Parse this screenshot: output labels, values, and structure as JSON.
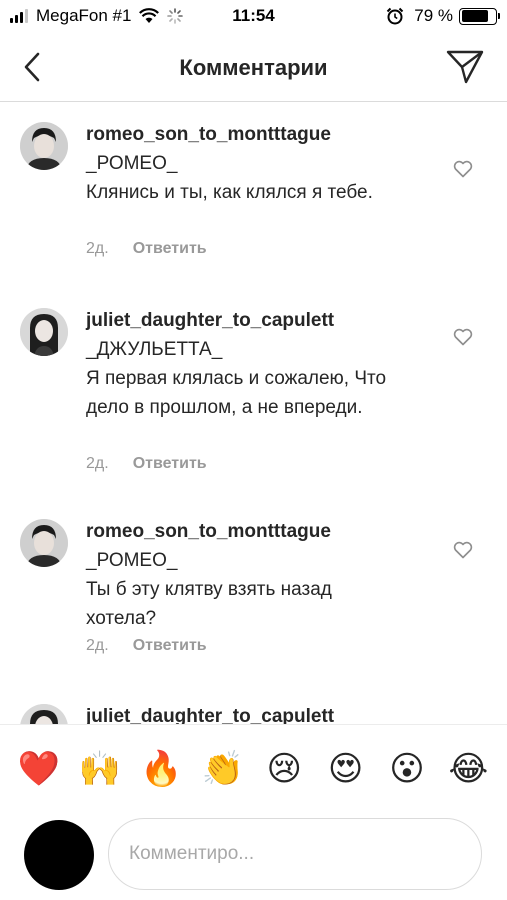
{
  "status_bar": {
    "carrier": "MegaFon #1",
    "time": "11:54",
    "battery": "79 %",
    "battery_level": 0.79
  },
  "nav": {
    "title": "Комментарии"
  },
  "comments": [
    {
      "username": "romeo_son_to_montttague",
      "text_line1": "_РОМЕО_",
      "text_line2": "Клянись и ты, как клялся я тебе.",
      "time": "2д.",
      "reply_label": "Ответить"
    },
    {
      "username": "juliet_daughter_to_capulett",
      "text_line1": "_ДЖУЛЬЕТТА_",
      "text_line2": "Я первая клялась и сожалею, Что дело в прошлом, а не впереди.",
      "time": "2д.",
      "reply_label": "Ответить"
    },
    {
      "username": "romeo_son_to_montttague",
      "text_line1": "_РОМЕО_",
      "text_line2": "Ты б эту клятву взять назад хотела?",
      "time": "2д.",
      "reply_label": "Ответить"
    },
    {
      "username": "juliet_daughter_to_capulett"
    }
  ],
  "emoji_bar": [
    "❤️",
    "🙌",
    "🔥",
    "👏",
    "😢",
    "😍",
    "😮",
    "😂"
  ],
  "input": {
    "placeholder": "Комментиро..."
  }
}
